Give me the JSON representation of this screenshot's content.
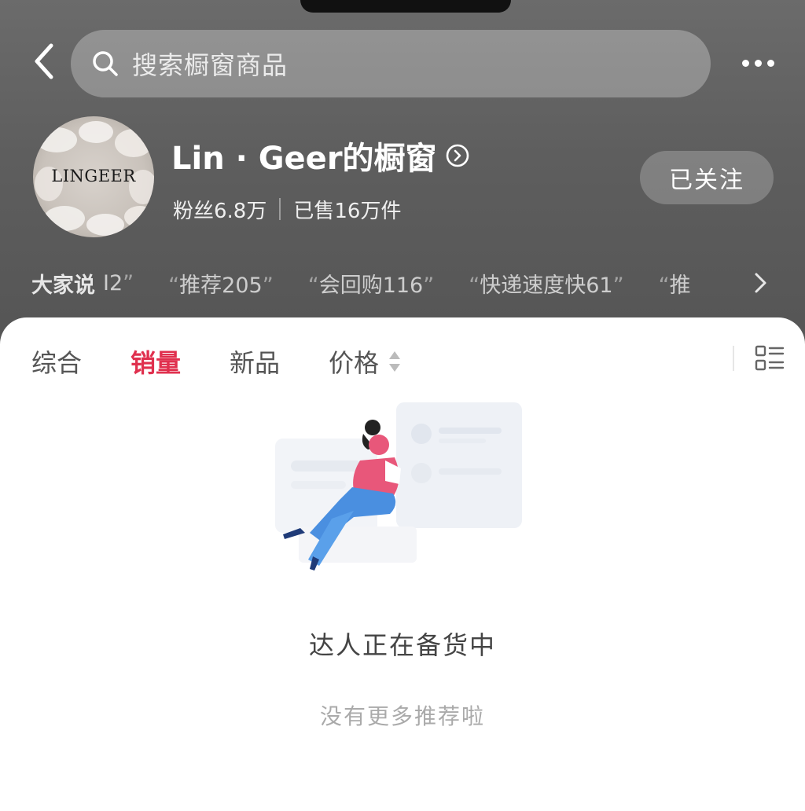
{
  "search": {
    "placeholder": "搜索橱窗商品"
  },
  "store": {
    "logo_text": "LINGEER",
    "title": "Lin · Geer的橱窗",
    "fans": "粉丝6.8万",
    "sold": "已售16万件",
    "follow_label": "已关注"
  },
  "reviews": {
    "label": "大家说",
    "tags": [
      {
        "text": "I2",
        "open": "",
        "close": "”"
      },
      {
        "text": "推荐205",
        "open": "“",
        "close": "”"
      },
      {
        "text": "会回购116",
        "open": "“",
        "close": "”"
      },
      {
        "text": "快递速度快61",
        "open": "“",
        "close": "”"
      },
      {
        "text": "推",
        "open": "“",
        "close": ""
      }
    ]
  },
  "sort_tabs": [
    {
      "label": "综合",
      "active": false
    },
    {
      "label": "销量",
      "active": true
    },
    {
      "label": "新品",
      "active": false
    },
    {
      "label": "价格",
      "active": false
    }
  ],
  "empty": {
    "title": "达人正在备货中",
    "subtitle": "没有更多推荐啦"
  },
  "colors": {
    "accent": "#e0304e",
    "header_bg": "#5e5e5e"
  },
  "icons": {
    "back": "chevron-left-icon",
    "search": "search-icon",
    "more": "more-dots-icon",
    "title_arrow": "circle-chevron-right-icon",
    "reviews_arrow": "chevron-right-icon",
    "price_sort": "sort-updown-icon",
    "layout": "list-layout-icon"
  }
}
